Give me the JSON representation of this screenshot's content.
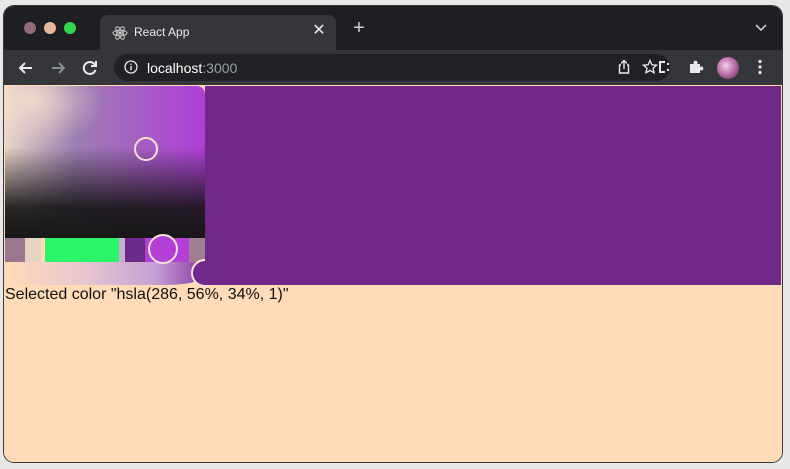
{
  "browser": {
    "tab": {
      "title": "React App",
      "icon": "react-atom-icon"
    },
    "new_tab_label": "+",
    "url": {
      "host": "localhost",
      "port": ":3000"
    },
    "icons": {
      "back": "back-arrow-icon",
      "forward": "forward-arrow-icon",
      "reload": "reload-icon",
      "info": "info-icon",
      "share": "share-icon",
      "bookmark": "star-icon",
      "extension_a": "extension-c-icon",
      "extensions": "puzzle-icon",
      "menu": "kebab-menu-icon"
    }
  },
  "picker": {
    "selected_color": "hsla(286, 56%, 34%, 1)",
    "hue": 286,
    "saturation_percent": 56,
    "lightness_percent": 34,
    "alpha": 1,
    "preview_color": "#722889"
  },
  "page": {
    "label_text": "Selected color \"hsla(286, 56%, 34%, 1)\""
  },
  "colors": {
    "page_background": "#ffdbb8",
    "preview": "#722889",
    "titlebar": "#1e1f22",
    "toolbar": "#35363a"
  }
}
